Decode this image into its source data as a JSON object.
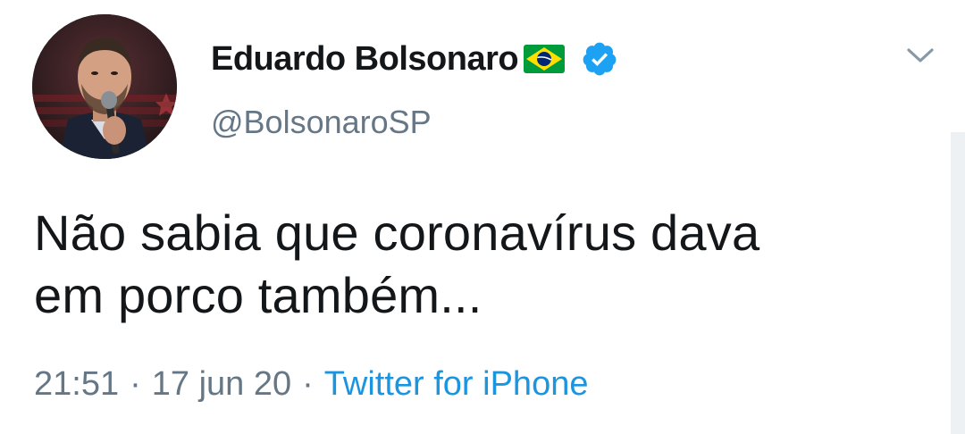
{
  "tweet": {
    "display_name": "Eduardo Bolsonaro",
    "handle": "@BolsonaroSP",
    "text_line1": "Não sabia que coronavírus dava",
    "text_line2": "em porco também...",
    "time": "21:51",
    "separator": "·",
    "date": "17 jun 20",
    "source": "Twitter for iPhone"
  },
  "icons": {
    "flag": "brazil-flag-emoji",
    "verified": "verified-badge",
    "menu": "chevron-down-icon"
  },
  "colors": {
    "name_text": "#14171a",
    "secondary_text": "#657786",
    "link": "#1b95e0",
    "verified": "#1da1f2",
    "flag_green": "#009b3a",
    "flag_yellow": "#fedf00",
    "flag_blue": "#002776"
  }
}
